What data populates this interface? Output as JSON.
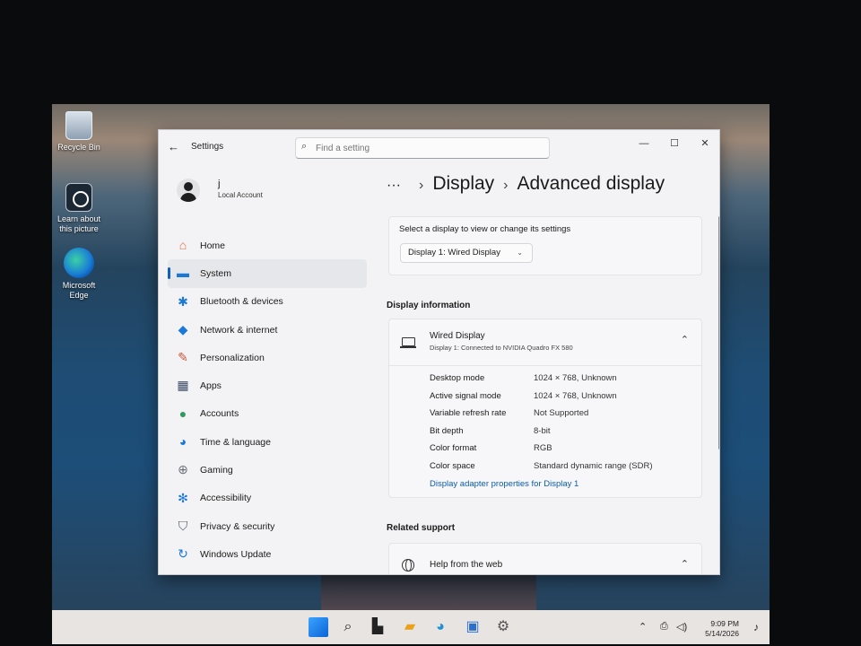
{
  "desktop": {
    "icons": [
      {
        "label": "Recycle Bin",
        "icon": "recycle-bin-icon"
      },
      {
        "label": "Learn about this picture",
        "icon": "learn-about-picture-icon"
      },
      {
        "label": "Microsoft Edge",
        "icon": "edge-icon"
      }
    ]
  },
  "window": {
    "title": "Settings",
    "search_placeholder": "Find a setting",
    "controls": {
      "minimize": "—",
      "maximize": "☐",
      "close": "✕"
    }
  },
  "profile": {
    "name": "j",
    "account_type": "Local Account"
  },
  "nav": [
    {
      "label": "Home",
      "icon": "home-icon",
      "glyph": "⌂",
      "color": "#e0673a"
    },
    {
      "label": "System",
      "icon": "system-icon",
      "glyph": "▬",
      "color": "#1a78d8",
      "selected": true
    },
    {
      "label": "Bluetooth & devices",
      "icon": "bluetooth-icon",
      "glyph": "✱",
      "color": "#1a78d8"
    },
    {
      "label": "Network & internet",
      "icon": "wifi-icon",
      "glyph": "◆",
      "color": "#1a78d8"
    },
    {
      "label": "Personalization",
      "icon": "brush-icon",
      "glyph": "✎",
      "color": "#c8553a"
    },
    {
      "label": "Apps",
      "icon": "apps-icon",
      "glyph": "▦",
      "color": "#3b4a66"
    },
    {
      "label": "Accounts",
      "icon": "accounts-icon",
      "glyph": "●",
      "color": "#2f9a5e"
    },
    {
      "label": "Time & language",
      "icon": "globe-clock-icon",
      "glyph": "◕",
      "color": "#1a78d8"
    },
    {
      "label": "Gaming",
      "icon": "gamepad-icon",
      "glyph": "⊕",
      "color": "#6b6f78"
    },
    {
      "label": "Accessibility",
      "icon": "accessibility-icon",
      "glyph": "✻",
      "color": "#1a78d8"
    },
    {
      "label": "Privacy & security",
      "icon": "shield-icon",
      "glyph": "⛉",
      "color": "#555b66"
    },
    {
      "label": "Windows Update",
      "icon": "windows-update-icon",
      "glyph": "↻",
      "color": "#1a78d8"
    }
  ],
  "breadcrumb": {
    "ellipsis": "···",
    "sep": "›",
    "parent": "Display",
    "current": "Advanced display"
  },
  "select_display": {
    "label": "Select a display to view or change its settings",
    "selected": "Display 1: Wired Display",
    "chevron": "⌄"
  },
  "display_information": {
    "section_title": "Display information",
    "name": "Wired Display",
    "subtitle": "Display 1: Connected to NVIDIA Quadro FX 580",
    "rows": [
      {
        "key": "Desktop mode",
        "value": "1024 × 768, Unknown"
      },
      {
        "key": "Active signal mode",
        "value": "1024 × 768, Unknown"
      },
      {
        "key": "Variable refresh rate",
        "value": "Not Supported"
      },
      {
        "key": "Bit depth",
        "value": "8-bit"
      },
      {
        "key": "Color format",
        "value": "RGB"
      },
      {
        "key": "Color space",
        "value": "Standard dynamic range (SDR)"
      }
    ],
    "adapter_link": "Display adapter properties for Display 1"
  },
  "related_support": {
    "section_title": "Related support",
    "help_label": "Help from the web"
  },
  "taskbar": {
    "icons": [
      "windows-start-icon",
      "search-icon",
      "task-view-icon",
      "file-explorer-icon",
      "edge-icon",
      "store-icon",
      "settings-icon"
    ],
    "time": "9:09 PM",
    "date": "5/14/2026"
  }
}
